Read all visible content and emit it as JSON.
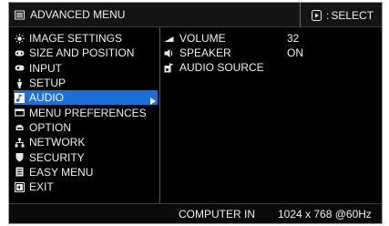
{
  "header": {
    "title": "ADVANCED MENU",
    "menu_icon": "menu-list-icon",
    "select_hint": "SELECT",
    "select_icon": "select-button-icon"
  },
  "left_menu": {
    "items": [
      {
        "label": "IMAGE SETTINGS",
        "icon": "sun-icon"
      },
      {
        "label": "SIZE AND POSITION",
        "icon": "resize-icon"
      },
      {
        "label": "INPUT",
        "icon": "input-icon"
      },
      {
        "label": "SETUP",
        "icon": "setup-icon"
      },
      {
        "label": "AUDIO",
        "icon": "music-note-icon",
        "active": true
      },
      {
        "label": "MENU PREFERENCES",
        "icon": "window-icon"
      },
      {
        "label": "OPTION",
        "icon": "option-icon"
      },
      {
        "label": "NETWORK",
        "icon": "network-icon"
      },
      {
        "label": "SECURITY",
        "icon": "shield-icon"
      },
      {
        "label": "EASY MENU",
        "icon": "easy-menu-icon"
      },
      {
        "label": "EXIT",
        "icon": "exit-icon"
      }
    ]
  },
  "audio_menu": {
    "items": [
      {
        "label": "VOLUME",
        "value": "32",
        "icon": "volume-icon"
      },
      {
        "label": "SPEAKER",
        "value": "ON",
        "icon": "speaker-icon"
      },
      {
        "label": "AUDIO SOURCE",
        "value": "",
        "icon": "audio-source-icon"
      }
    ]
  },
  "footer": {
    "input_source": "COMPUTER IN",
    "signal": "1024 x 768 @60Hz"
  },
  "colors": {
    "background": "#000000",
    "highlight": "#1d6fd8",
    "text": "#f0f0f0"
  }
}
